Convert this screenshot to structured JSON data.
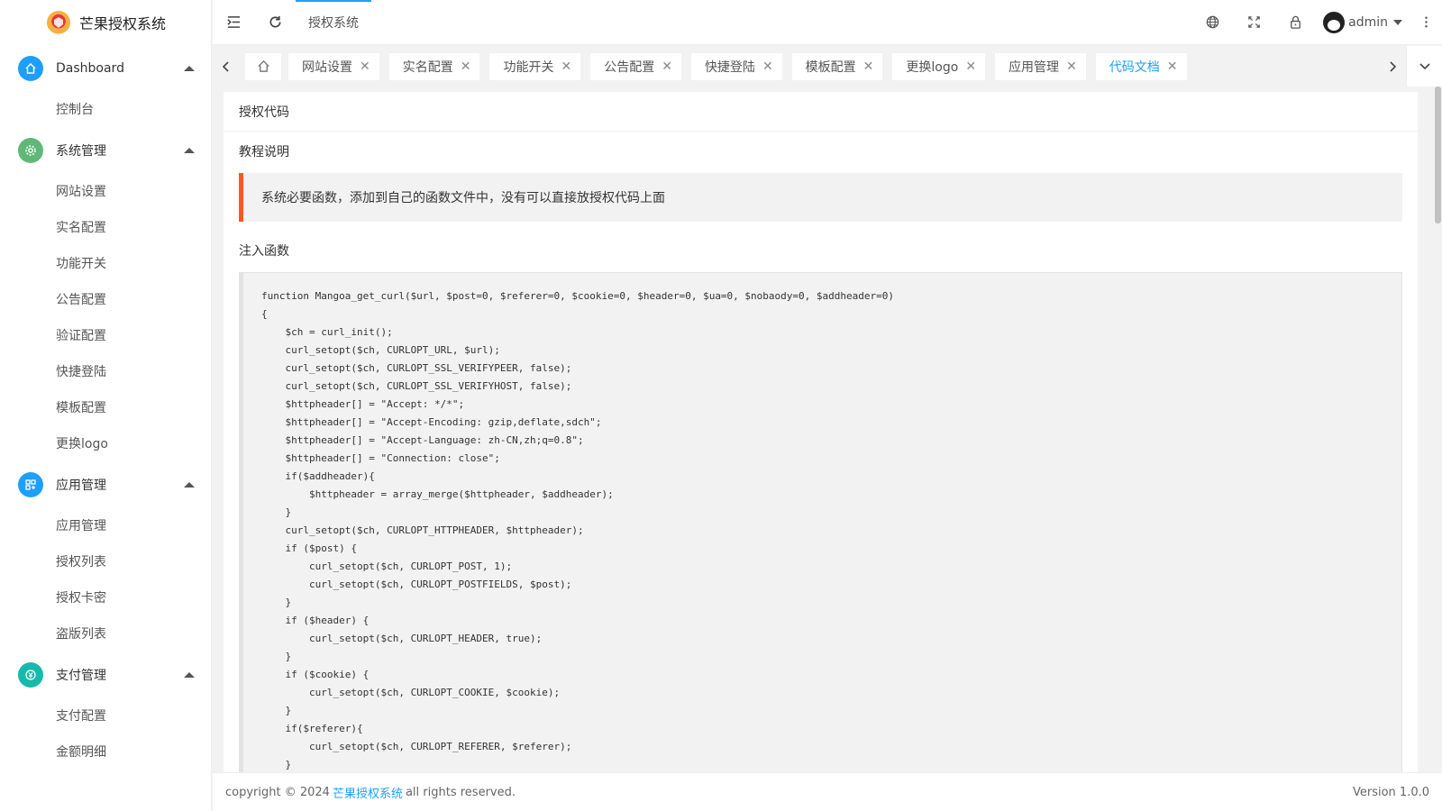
{
  "brand": {
    "title": "芒果授权系统"
  },
  "sidebar": {
    "groups": [
      {
        "label": "Dashboard",
        "icon": "home-icon",
        "color": "#1e9fff",
        "items": [
          "控制台"
        ]
      },
      {
        "label": "系统管理",
        "icon": "gear-icon",
        "color": "#5fb878",
        "items": [
          "网站设置",
          "实名配置",
          "功能开关",
          "公告配置",
          "验证配置",
          "快捷登陆",
          "模板配置",
          "更换logo"
        ]
      },
      {
        "label": "应用管理",
        "icon": "apps-icon",
        "color": "#1e9fff",
        "items": [
          "应用管理",
          "授权列表",
          "授权卡密",
          "盗版列表"
        ]
      },
      {
        "label": "支付管理",
        "icon": "pay-icon",
        "color": "#16baaa",
        "items": [
          "支付配置",
          "金额明细"
        ]
      }
    ]
  },
  "header": {
    "nav_label": "授权系统",
    "user": "admin",
    "accent": "#1e9fff"
  },
  "tabs": {
    "items": [
      "网站设置",
      "实名配置",
      "功能开关",
      "公告配置",
      "快捷登陆",
      "模板配置",
      "更换logo",
      "应用管理",
      "代码文档"
    ],
    "active": 8,
    "close_glyph": "✕"
  },
  "content": {
    "card_title": "授权代码",
    "section_title": "教程说明",
    "note": "系统必要函数，添加到自己的函数文件中，没有可以直接放授权代码上面",
    "section_title2": "注入函数",
    "code_lines": [
      "function Mangoa_get_curl($url, $post=0, $referer=0, $cookie=0, $header=0, $ua=0, $nobaody=0, $addheader=0)",
      "{",
      "    $ch = curl_init();",
      "    curl_setopt($ch, CURLOPT_URL, $url);",
      "    curl_setopt($ch, CURLOPT_SSL_VERIFYPEER, false);",
      "    curl_setopt($ch, CURLOPT_SSL_VERIFYHOST, false);",
      "    $httpheader[] = \"Accept: */*\";",
      "    $httpheader[] = \"Accept-Encoding: gzip,deflate,sdch\";",
      "    $httpheader[] = \"Accept-Language: zh-CN,zh;q=0.8\";",
      "    $httpheader[] = \"Connection: close\";",
      "    if($addheader){",
      "        $httpheader = array_merge($httpheader, $addheader);",
      "    }",
      "    curl_setopt($ch, CURLOPT_HTTPHEADER, $httpheader);",
      "    if ($post) {",
      "        curl_setopt($ch, CURLOPT_POST, 1);",
      "        curl_setopt($ch, CURLOPT_POSTFIELDS, $post);",
      "    }",
      "    if ($header) {",
      "        curl_setopt($ch, CURLOPT_HEADER, true);",
      "    }",
      "    if ($cookie) {",
      "        curl_setopt($ch, CURLOPT_COOKIE, $cookie);",
      "    }",
      "    if($referer){",
      "        curl_setopt($ch, CURLOPT_REFERER, $referer);",
      "    }"
    ]
  },
  "footer": {
    "prefix": "copyright © 2024 ",
    "link": "芒果授权系统",
    "suffix": " all rights reserved.",
    "version": "Version 1.0.0"
  }
}
